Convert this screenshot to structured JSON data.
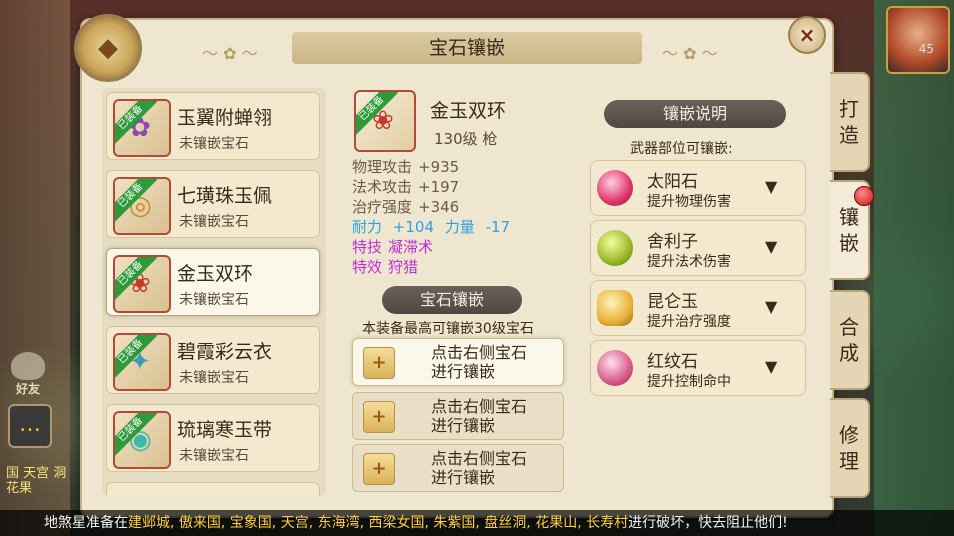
{
  "window": {
    "title": "宝石镶嵌",
    "close_symbol": "×"
  },
  "background": {
    "friend_label": "好友",
    "chat_icon": "chat-bubble-icon",
    "left_msg": "国 天宫 洞 花果",
    "right_badge": "45"
  },
  "equipment_list": [
    {
      "name": "玉翼附蝉翎",
      "status": "未镶嵌宝石",
      "tag": "已装备",
      "glyph": "✿"
    },
    {
      "name": "七璜珠玉佩",
      "status": "未镶嵌宝石",
      "tag": "已装备",
      "glyph": "◎"
    },
    {
      "name": "金玉双环",
      "status": "未镶嵌宝石",
      "tag": "已装备",
      "glyph": "❀"
    },
    {
      "name": "碧霞彩云衣",
      "status": "未镶嵌宝石",
      "tag": "已装备",
      "glyph": "✦"
    },
    {
      "name": "琉璃寒玉带",
      "status": "未镶嵌宝石",
      "tag": "已装备",
      "glyph": "◉"
    }
  ],
  "detail": {
    "tag": "已装备",
    "name": "金玉双环",
    "level": "130级  枪",
    "stats": [
      {
        "label": "物理攻击",
        "value": "+935"
      },
      {
        "label": "法术攻击",
        "value": "+197"
      },
      {
        "label": "治疗强度",
        "value": "+346"
      }
    ],
    "attr_line": {
      "a": "耐力",
      "av": "+104",
      "b": "力量",
      "bv": "-17"
    },
    "skill": {
      "label": "特技",
      "value": "凝滞术"
    },
    "effect": {
      "label": "特效",
      "value": "狩猎"
    }
  },
  "gem_section": {
    "title": "宝石镶嵌",
    "limit": "本装备最高可镶嵌30级宝石",
    "slots": [
      {
        "plus": "+",
        "text1": "点击右侧宝石",
        "text2": "进行镶嵌"
      },
      {
        "plus": "+",
        "text1": "点击右侧宝石",
        "text2": "进行镶嵌"
      },
      {
        "plus": "+",
        "text1": "点击右侧宝石",
        "text2": "进行镶嵌"
      }
    ]
  },
  "gem_panel": {
    "title": "镶嵌说明",
    "caption": "武器部位可镶嵌:",
    "gems": [
      {
        "name": "太阳石",
        "desc": "提升物理伤害",
        "color": "#e0356a"
      },
      {
        "name": "舍利子",
        "desc": "提升法术伤害",
        "color": "#9ab82a"
      },
      {
        "name": "昆仑玉",
        "desc": "提升治疗强度",
        "color": "#e8b43a"
      },
      {
        "name": "红纹石",
        "desc": "提升控制命中",
        "color": "#d85a8a"
      }
    ],
    "arrow": "▼"
  },
  "tabs": [
    {
      "label": "打造"
    },
    {
      "label": "镶嵌"
    },
    {
      "label": "合成"
    },
    {
      "label": "修理"
    }
  ],
  "ticker": {
    "prefix": "地煞星准备在",
    "cities": "建邺城, 傲来国, 宝象国, 天宫, 东海湾, 西梁女国, 朱紫国, 盘丝洞, 花果山, 长寿村",
    "suffix": "进行破坏，快去阻止他们!"
  }
}
